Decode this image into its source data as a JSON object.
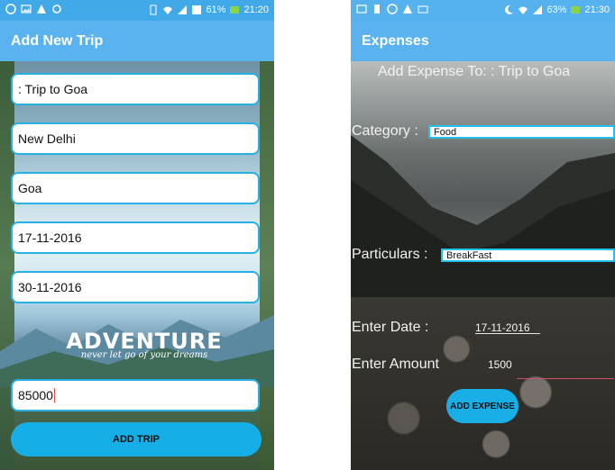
{
  "left_screen": {
    "status_bar": {
      "battery_text": "61%",
      "time": "21:20"
    },
    "title": "Add New Trip",
    "fields": [
      ": Trip to Goa",
      "New Delhi",
      "Goa",
      "17-11-2016",
      "30-11-2016"
    ],
    "adventure_title": "ADVENTURE",
    "adventure_tagline": "never let go of your dreams",
    "amount_value": "85000",
    "add_trip_label": "ADD TRIP",
    "colors": {
      "accent": "#16aee6",
      "appbar": "#5ab3ee",
      "field_border": "#27b0e2"
    }
  },
  "right_screen": {
    "status_bar": {
      "battery_text": "63%",
      "time": "21:30"
    },
    "title": "Expenses",
    "heading": "Add Expense To: : Trip to Goa",
    "category_label": "Category :",
    "category_value": "Food",
    "particulars_label": "Particulars :",
    "particulars_value": "BreakFast",
    "date_label": "Enter Date :",
    "date_value": "17-11-2016",
    "amount_label": "Enter Amount",
    "amount_value": "1500",
    "add_expense_label": "ADD EXPENSE",
    "colors": {
      "accent": "#1aaee6",
      "input_border": "#23c0ea"
    }
  }
}
